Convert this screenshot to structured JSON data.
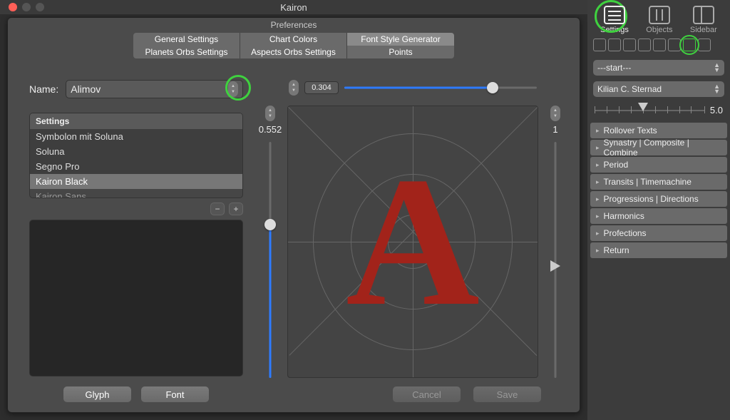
{
  "window": {
    "title": "Kairon"
  },
  "prefs": {
    "title": "Preferences",
    "tabs_row1": [
      "General Settings",
      "Chart Colors",
      "Font Style Generator"
    ],
    "tabs_row2": [
      "Planets Orbs Settings",
      "Aspects Orbs Settings",
      "Points"
    ],
    "active_tab": "Font Style Generator"
  },
  "form": {
    "name_label": "Name:",
    "name_value": "Alimov",
    "settings_header": "Settings",
    "settings_items": [
      "Symbolon mit Soluna",
      "Soluna",
      "Segno Pro",
      "Kairon Black",
      "Kairon Sans"
    ],
    "selected_setting": "Kairon Black",
    "glyph_btn": "Glyph",
    "font_btn": "Font",
    "cancel_btn": "Cancel",
    "save_btn": "Save",
    "horiz_value": "0.304",
    "left_value": "0.552",
    "right_value": "1",
    "glyph_letter": "A"
  },
  "sidebar": {
    "top": {
      "settings": "Settings",
      "objects": "Objects",
      "sidebar": "Sidebar"
    },
    "select1": "---start---",
    "select2": "Kilian C. Sternad",
    "tick_value": "5.0",
    "accordion": [
      "Rollover Texts",
      "Synastry | Composite | Combine",
      "Period",
      "Transits | Timemachine",
      "Progressions | Directions",
      "Harmonics",
      "Profections",
      "Return"
    ]
  }
}
